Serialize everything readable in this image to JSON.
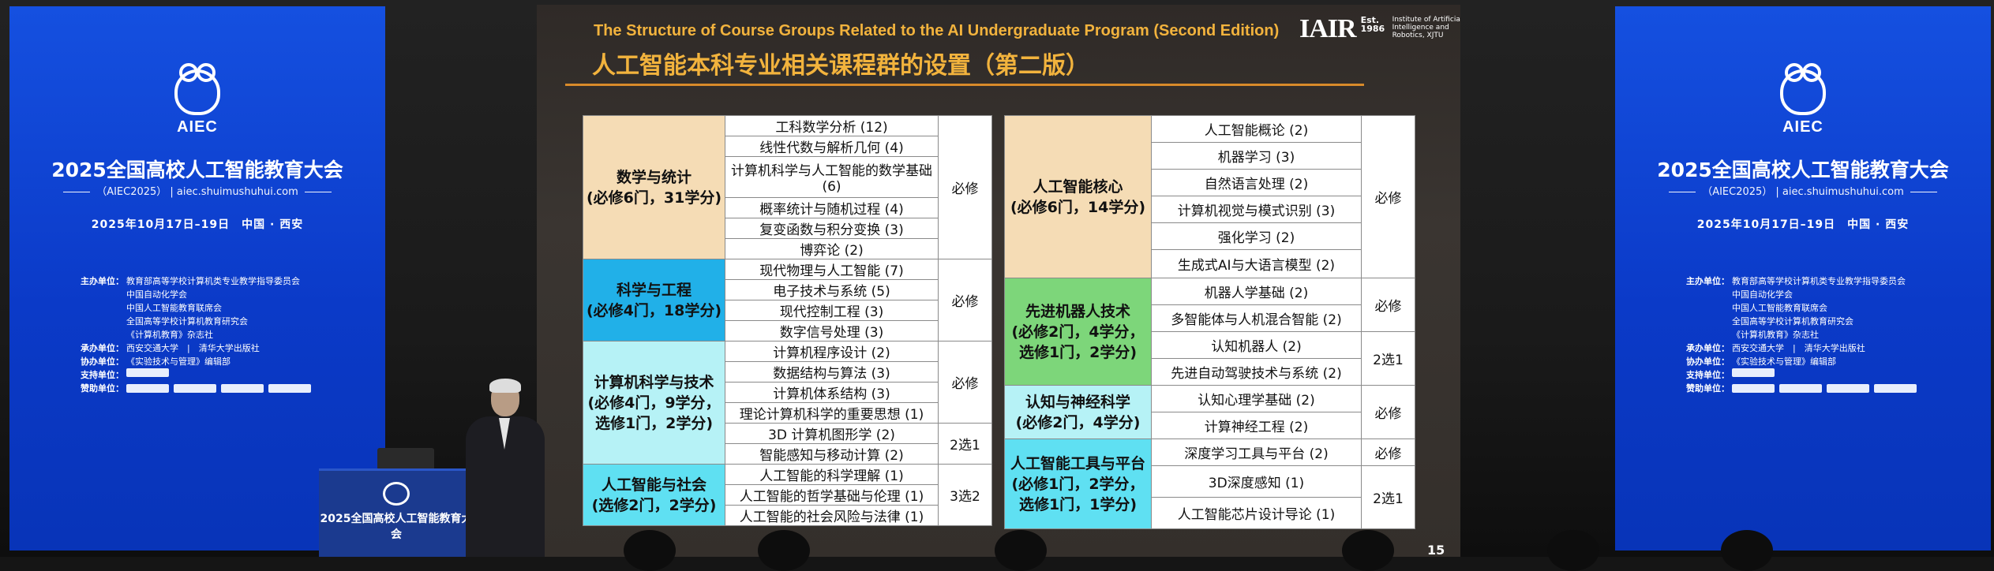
{
  "conference": {
    "logo_text": "AIEC",
    "title": "2025全国高校人工智能教育大会",
    "subtitle": "（AIEC2025） | aiec.shuimushuhui.com",
    "date": "2025年10月17日–19日　中国 · 西安",
    "organizers": [
      {
        "key": "主办单位：",
        "value": "教育部高等学校计算机类专业教学指导委员会"
      },
      {
        "key": "",
        "value": "中国自动化学会"
      },
      {
        "key": "",
        "value": "中国人工智能教育联席会"
      },
      {
        "key": "",
        "value": "全国高等学校计算机教育研究会"
      },
      {
        "key": "",
        "value": "《计算机教育》杂志社"
      },
      {
        "key": "承办单位：",
        "value": "西安交通大学　|　清华大学出版社"
      },
      {
        "key": "协办单位：",
        "value": "《实验技术与管理》编辑部"
      },
      {
        "key": "支持单位：",
        "value": ""
      },
      {
        "key": "赞助单位：",
        "value": ""
      }
    ],
    "podium_title": "2025全国高校人工智能教育大会"
  },
  "slide": {
    "title_en": "The Structure of Course Groups  Related to the  AI Undergraduate Program  (Second Edition)",
    "title_cn": "人工智能本科专业相关课程群的设置（第二版）",
    "institute_abbr": "IAIR",
    "institute_est": "Est. 1986",
    "institute_full": "Institute of Artificial Intelligence and Robotics, XJTU",
    "page_number": "15",
    "left_table": {
      "groups": [
        {
          "name": "数学与统计\n(必修6门，31学分)",
          "color": "#f5dcb5",
          "courses": [
            "工科数学分析 (12)",
            "线性代数与解析几何 (4)",
            "计算机科学与人工智能的数学基础 (6)",
            "概率统计与随机过程 (4)",
            "复变函数与积分变换 (3)",
            "博弈论 (2)"
          ],
          "req": "必修"
        },
        {
          "name": "科学与工程\n(必修4门，18学分)",
          "color": "#21b0e8",
          "courses": [
            "现代物理与人工智能 (7)",
            "电子技术与系统 (5)",
            "现代控制工程 (3)",
            "数字信号处理 (3)"
          ],
          "req": "必修"
        },
        {
          "name": "计算机科学与技术\n(必修4门，9学分，\n选修1门，2学分)",
          "color": "#b6f2f6",
          "courses": [
            "计算机程序设计 (2)",
            "数据结构与算法 (3)",
            "计算机体系结构 (3)",
            "理论计算机科学的重要思想 (1)",
            "3D 计算机图形学 (2)",
            "智能感知与移动计算 (2)"
          ],
          "req": "必修",
          "req2": "2选1"
        },
        {
          "name": "人工智能与社会\n(选修2门，2学分)",
          "color": "#5fe0f2",
          "courses": [
            "人工智能的科学理解 (1)",
            "人工智能的哲学基础与伦理 (1)",
            "人工智能的社会风险与法律 (1)"
          ],
          "req": "3选2"
        }
      ]
    },
    "right_table": {
      "groups": [
        {
          "name": "人工智能核心\n(必修6门，14学分)",
          "color": "#f5dcb5",
          "courses": [
            "人工智能概论 (2)",
            "机器学习 (3)",
            "自然语言处理 (2)",
            "计算机视觉与模式识别 (3)",
            "强化学习 (2)",
            "生成式AI与大语言模型 (2)"
          ],
          "req": "必修"
        },
        {
          "name": "先进机器人技术\n(必修2门，4学分，\n选修1门，2学分)",
          "color": "#7dd67a",
          "courses": [
            "机器人学基础 (2)",
            "多智能体与人机混合智能 (2)",
            "认知机器人 (2)",
            "先进自动驾驶技术与系统 (2)"
          ],
          "req": "必修",
          "req2": "2选1"
        },
        {
          "name": "认知与神经科学\n(必修2门，4学分)",
          "color": "#b6f2f6",
          "courses": [
            "认知心理学基础 (2)",
            "计算神经工程 (2)"
          ],
          "req": "必修"
        },
        {
          "name": "人工智能工具与平台\n(必修1门，2学分，\n选修1门，1学分)",
          "color": "#5fe0f2",
          "courses": [
            "深度学习工具与平台 (2)",
            "3D深度感知 (1)",
            "人工智能芯片设计导论 (1)"
          ],
          "req": "必修",
          "req2": "2选1"
        }
      ]
    }
  }
}
